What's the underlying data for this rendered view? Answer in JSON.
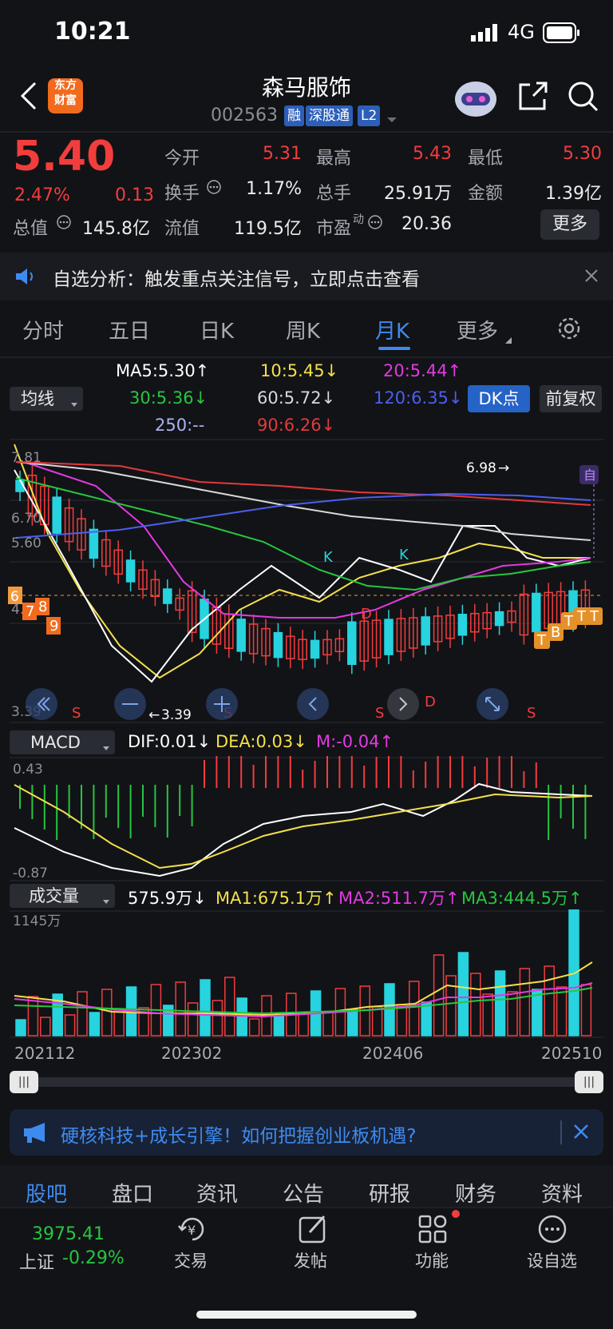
{
  "status": {
    "time": "10:21",
    "network": "4G"
  },
  "header": {
    "title": "森马服饰",
    "code": "002563",
    "tags": [
      "融",
      "深股通",
      "L2"
    ],
    "logo_text": "东方财富"
  },
  "quote": {
    "price": "5.40",
    "change_pct": "2.47%",
    "change": "0.13",
    "fields": [
      {
        "label": "今开",
        "value": "5.31",
        "color": "red"
      },
      {
        "label": "最高",
        "value": "5.43",
        "color": "red"
      },
      {
        "label": "最低",
        "value": "5.30",
        "color": "red"
      },
      {
        "label": "换手",
        "value": "1.17%",
        "color": "white"
      },
      {
        "label": "总手",
        "value": "25.91万",
        "color": "white"
      },
      {
        "label": "金额",
        "value": "1.39亿",
        "color": "white"
      },
      {
        "label": "总值",
        "value": "145.8亿",
        "color": "white"
      },
      {
        "label": "流值",
        "value": "119.5亿",
        "color": "white"
      },
      {
        "label": "市盈",
        "value": "20.36",
        "color": "white"
      }
    ],
    "more_label": "更多",
    "pe_sup": "动"
  },
  "notice": {
    "text": "自选分析：触发重点关注信号，立即点击查看"
  },
  "tabs": [
    "分时",
    "五日",
    "日K",
    "周K",
    "月K",
    "更多"
  ],
  "active_tab": "月K",
  "ma": {
    "selector": "均线",
    "items": [
      "MA5:5.30↑",
      "10:5.45↓",
      "20:5.44↑",
      "30:5.36↓",
      "60:5.72↓",
      "120:6.35↓",
      "250:--",
      "90:6.26↓"
    ],
    "dk_label": "DK点",
    "fq_label": "前复权"
  },
  "kline": {
    "ticks": [
      "7.81",
      "6.70",
      "5.60",
      "4.49",
      "3.39"
    ],
    "high_label": "6.98",
    "low_label": "3.39",
    "current_marker": "6",
    "self_marker": "自",
    "signals": [
      "7",
      "8",
      "9",
      "K",
      "K",
      "D",
      "D",
      "T",
      "B",
      "T",
      "T",
      "T",
      "S",
      "S",
      "S",
      "S"
    ]
  },
  "macd": {
    "selector": "MACD",
    "dif": "DIF:0.01↓",
    "dea": "DEA:0.03↓",
    "m": "M:-0.04↑",
    "top": "0.43",
    "bottom": "-0.87"
  },
  "volume": {
    "selector": "成交量",
    "value": "575.9万↓",
    "ma1": "MA1:675.1万↑",
    "ma2": "MA2:511.7万↑",
    "ma3": "MA3:444.5万↑",
    "top": "1145万"
  },
  "x_labels": [
    "202112",
    "202302",
    "202406",
    "202510"
  ],
  "promo": {
    "text": "硬核科技+成长引擎！如何把握创业板机遇?"
  },
  "bottom_tabs": [
    "股吧",
    "盘口",
    "资讯",
    "公告",
    "研报",
    "财务",
    "资料"
  ],
  "nav": {
    "index_value": "3975.41",
    "index_name": "上证",
    "index_change": "-0.29%",
    "items": [
      "交易",
      "发帖",
      "功能",
      "设自选"
    ]
  },
  "colors": {
    "up": "#f23d3d",
    "down": "#27d3de",
    "accent": "#3e8bf0",
    "bg": "#121317"
  }
}
